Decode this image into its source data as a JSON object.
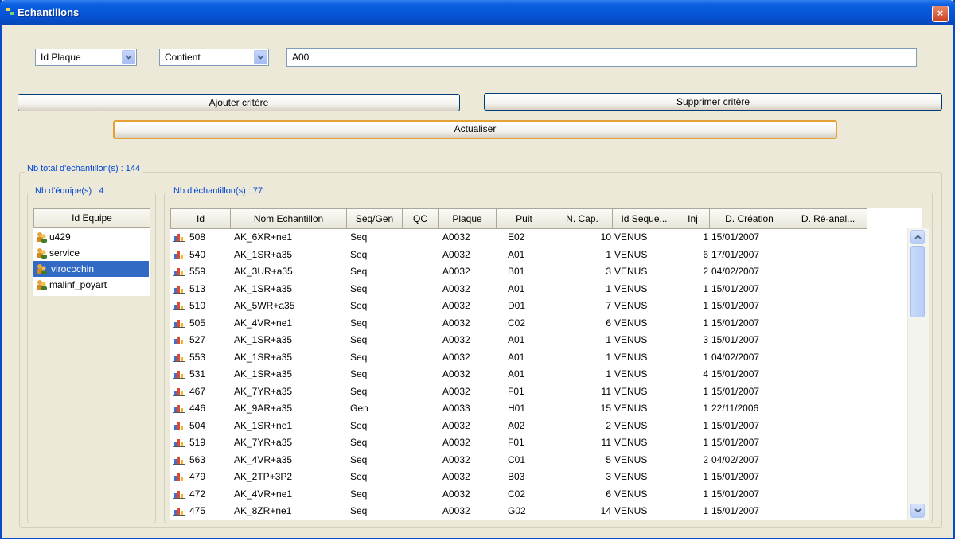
{
  "window": {
    "title": "Echantillons",
    "close_label": "×"
  },
  "filter": {
    "field_selected": "Id Plaque",
    "operator_selected": "Contient",
    "value": "A00",
    "add_label": "Ajouter critère",
    "remove_label": "Supprimer critère",
    "refresh_label": "Actualiser"
  },
  "totals": {
    "total_label": "Nb total d'échantillon(s) : 144"
  },
  "teams": {
    "group_label": "Nb d'équipe(s) : 4",
    "column": "Id Equipe",
    "items": [
      "u429",
      "service",
      "virocochin",
      "malinf_poyart"
    ],
    "selected_index": 2
  },
  "samples": {
    "group_label": "Nb d'échantillon(s) : 77",
    "columns": [
      "Id",
      "Nom Echantillon",
      "Seq/Gen",
      "QC",
      "Plaque",
      "Puit",
      "N. Cap.",
      "Id Seque...",
      "Inj",
      "D. Création",
      "D. Ré-anal..."
    ],
    "rows": [
      [
        "508",
        "AK_6XR+ne1",
        "Seq",
        "",
        "A0032",
        "E02",
        "10",
        "VENUS",
        "1",
        "15/01/2007",
        ""
      ],
      [
        "540",
        "AK_1SR+a35",
        "Seq",
        "",
        "A0032",
        "A01",
        "1",
        "VENUS",
        "6",
        "17/01/2007",
        ""
      ],
      [
        "559",
        "AK_3UR+a35",
        "Seq",
        "",
        "A0032",
        "B01",
        "3",
        "VENUS",
        "2",
        "04/02/2007",
        ""
      ],
      [
        "513",
        "AK_1SR+a35",
        "Seq",
        "",
        "A0032",
        "A01",
        "1",
        "VENUS",
        "1",
        "15/01/2007",
        ""
      ],
      [
        "510",
        "AK_5WR+a35",
        "Seq",
        "",
        "A0032",
        "D01",
        "7",
        "VENUS",
        "1",
        "15/01/2007",
        ""
      ],
      [
        "505",
        "AK_4VR+ne1",
        "Seq",
        "",
        "A0032",
        "C02",
        "6",
        "VENUS",
        "1",
        "15/01/2007",
        ""
      ],
      [
        "527",
        "AK_1SR+a35",
        "Seq",
        "",
        "A0032",
        "A01",
        "1",
        "VENUS",
        "3",
        "15/01/2007",
        ""
      ],
      [
        "553",
        "AK_1SR+a35",
        "Seq",
        "",
        "A0032",
        "A01",
        "1",
        "VENUS",
        "1",
        "04/02/2007",
        ""
      ],
      [
        "531",
        "AK_1SR+a35",
        "Seq",
        "",
        "A0032",
        "A01",
        "1",
        "VENUS",
        "4",
        "15/01/2007",
        ""
      ],
      [
        "467",
        "AK_7YR+a35",
        "Seq",
        "",
        "A0032",
        "F01",
        "11",
        "VENUS",
        "1",
        "15/01/2007",
        ""
      ],
      [
        "446",
        "AK_9AR+a35",
        "Gen",
        "",
        "A0033",
        "H01",
        "15",
        "VENUS",
        "1",
        "22/11/2006",
        ""
      ],
      [
        "504",
        "AK_1SR+ne1",
        "Seq",
        "",
        "A0032",
        "A02",
        "2",
        "VENUS",
        "1",
        "15/01/2007",
        ""
      ],
      [
        "519",
        "AK_7YR+a35",
        "Seq",
        "",
        "A0032",
        "F01",
        "11",
        "VENUS",
        "1",
        "15/01/2007",
        ""
      ],
      [
        "563",
        "AK_4VR+a35",
        "Seq",
        "",
        "A0032",
        "C01",
        "5",
        "VENUS",
        "2",
        "04/02/2007",
        ""
      ],
      [
        "479",
        "AK_2TP+3P2",
        "Seq",
        "",
        "A0032",
        "B03",
        "3",
        "VENUS",
        "1",
        "15/01/2007",
        ""
      ],
      [
        "472",
        "AK_4VR+ne1",
        "Seq",
        "",
        "A0032",
        "C02",
        "6",
        "VENUS",
        "1",
        "15/01/2007",
        ""
      ],
      [
        "475",
        "AK_8ZR+ne1",
        "Seq",
        "",
        "A0032",
        "G02",
        "14",
        "VENUS",
        "1",
        "15/01/2007",
        ""
      ]
    ]
  },
  "icons": {
    "close": "close-icon",
    "team": "user-group-icon",
    "sample": "bar-chart-icon",
    "dropdown": "chevron-down-icon"
  }
}
